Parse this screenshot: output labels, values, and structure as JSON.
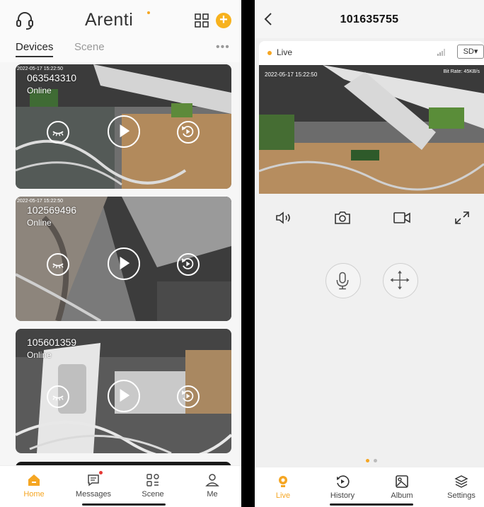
{
  "left": {
    "brand": "Arenti",
    "tabs": {
      "devices": "Devices",
      "scene": "Scene"
    },
    "more": "•••",
    "add_symbol": "+",
    "cameras": [
      {
        "id": "063543310",
        "status": "Online",
        "timestamp": "2022-05-17 15:22:50"
      },
      {
        "id": "102569496",
        "status": "Online",
        "timestamp": "2022-05-17 15:22:50"
      },
      {
        "id": "105601359",
        "status": "Online",
        "timestamp": ""
      }
    ],
    "nav": {
      "home": "Home",
      "messages": "Messages",
      "scene": "Scene",
      "me": "Me"
    }
  },
  "right": {
    "title": "101635755",
    "live": "Live",
    "quality": "SD▾",
    "timestamp": "2022-05-17 15:22:50",
    "bitrate": "Bit Rate: 45KB/s",
    "nav": {
      "live": "Live",
      "history": "History",
      "album": "Album",
      "settings": "Settings"
    }
  },
  "colors": {
    "accent": "#f5a623",
    "badge": "#e53935"
  },
  "icons": [
    "headset-icon",
    "grid-icon",
    "plus-icon",
    "eye-closed-icon",
    "play-icon",
    "replay-icon",
    "home-icon",
    "message-icon",
    "scene-icon",
    "user-icon",
    "chevron-left-icon",
    "signal-icon",
    "speaker-icon",
    "camera-icon",
    "video-record-icon",
    "fullscreen-icon",
    "microphone-icon",
    "move-icon",
    "live-icon",
    "history-icon",
    "album-icon",
    "settings-icon"
  ]
}
